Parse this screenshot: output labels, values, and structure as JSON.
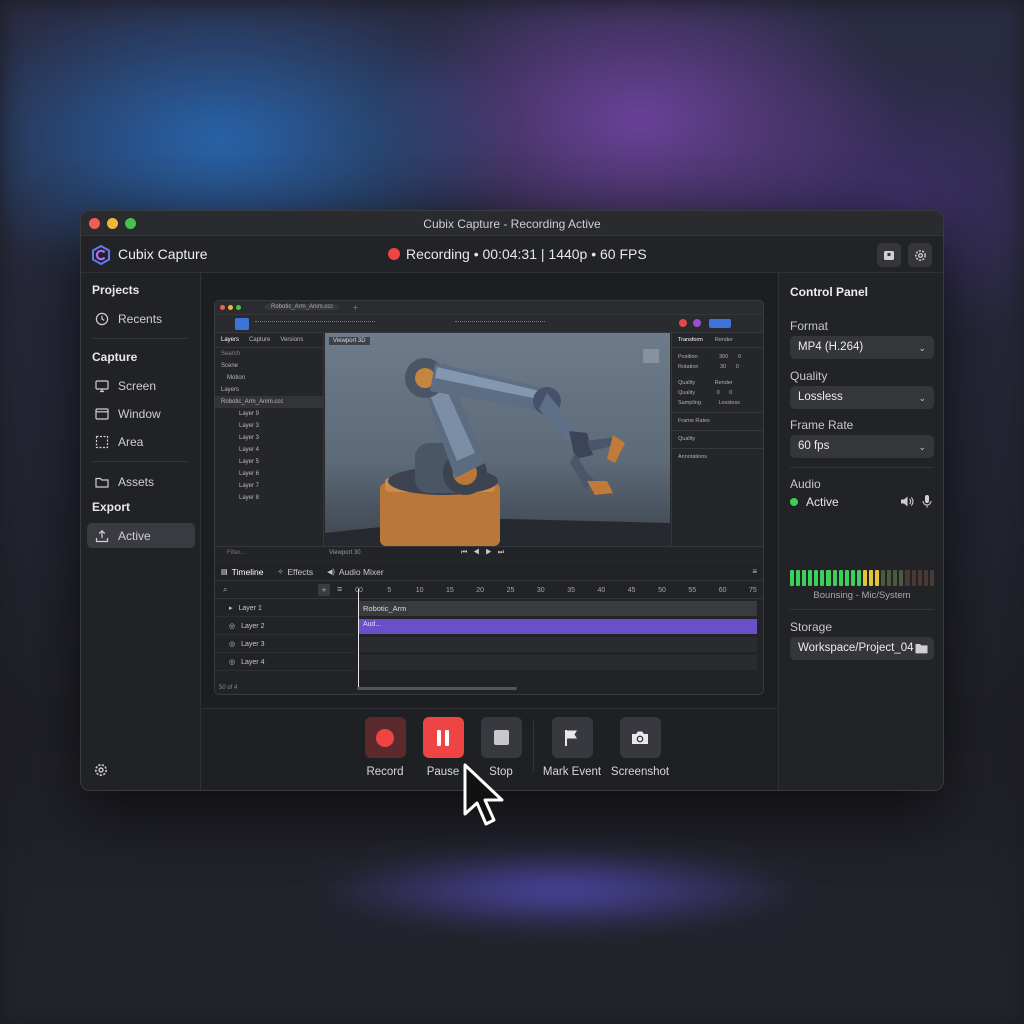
{
  "window": {
    "title": "Cubix Capture - Recording Active"
  },
  "header": {
    "app_name": "Cubix Capture",
    "recording_status": "Recording • 00:04:31 | 1440p • 60 FPS",
    "status_color": "#ef4444"
  },
  "sidebar": {
    "projects_heading": "Projects",
    "recents_label": "Recents",
    "capture_heading": "Capture",
    "screen_label": "Screen",
    "window_label": "Window",
    "area_label": "Area",
    "assets_label": "Assets",
    "export_heading": "Export",
    "active_label": "Active"
  },
  "preview": {
    "tab_title": "Robotic_Arm_Anim.ccc",
    "layers_tab": "Layers",
    "layers_tab2": "Capture",
    "layers_tab3": "Versions",
    "search_placeholder": "Search",
    "tree": [
      "Scene",
      "Motion",
      "Layers",
      "Robotic_Arm_Anim.ccc",
      "Layer 9",
      "Layer 3",
      "Layer 3",
      "Layer 4",
      "Layer 5",
      "Layer 6",
      "Layer 7",
      "Layer 8"
    ],
    "viewport_label": "Viewport 3D",
    "viewport_footer": "Viewport 30",
    "filter_placeholder": "Filter...",
    "right_tab1": "Transform",
    "right_tab2": "Render",
    "right_rows": [
      [
        "Position",
        "300",
        "0"
      ],
      [
        "Rotation",
        "30",
        "0"
      ],
      [
        "Quality",
        "Render",
        ""
      ],
      [
        "Quality",
        "0",
        "0"
      ],
      [
        "Sampling",
        "Lossless",
        ""
      ]
    ],
    "right_sections": [
      "Frame Rates",
      "Quality",
      "Annotations"
    ],
    "timeline_tab": "Timeline",
    "effects_tab": "Effects",
    "audio_tab": "Audio Mixer",
    "ruler_ticks": [
      "00",
      "5",
      "10",
      "15",
      "20",
      "25",
      "30",
      "35",
      "40",
      "45",
      "50",
      "55",
      "60",
      "75"
    ],
    "layers": [
      "Layer 1",
      "Layer 2",
      "Layer 3",
      "Layer 4"
    ],
    "clip_name": "Robotic_Arm",
    "clip2_label": "Aud...",
    "clip_color": "#6a4fc8",
    "bottom_status": "50 of 4"
  },
  "controls": {
    "record_label": "Record",
    "pause_label": "Pause",
    "stop_label": "Stop",
    "mark_label": "Mark Event",
    "screenshot_label": "Screenshot"
  },
  "control_panel": {
    "title": "Control Panel",
    "format_label": "Format",
    "format_value": "MP4 (H.264)",
    "quality_label": "Quality",
    "quality_value": "Lossless",
    "framerate_label": "Frame Rate",
    "framerate_value": "60 fps",
    "audio_label": "Audio",
    "audio_status": "Active",
    "audio_status_color": "#3ecf5a",
    "audio_source": "Bounsing - Mic/System",
    "storage_label": "Storage",
    "storage_value": "Workspace/Project_04"
  }
}
